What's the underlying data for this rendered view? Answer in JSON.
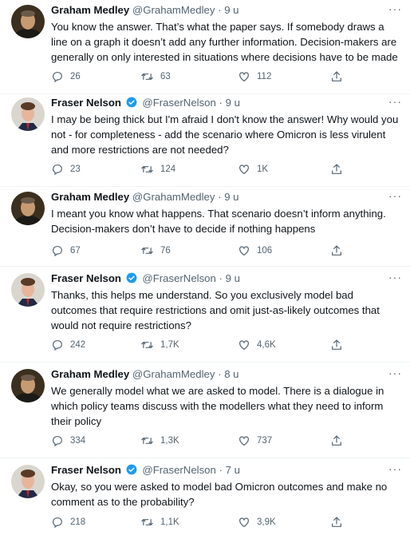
{
  "tweets": [
    {
      "name": "Graham Medley",
      "handle": "@GrahamMedley",
      "time": "9 u",
      "verified": false,
      "text": "You know the answer. That’s what the paper says. If somebody draws a line on a graph it doesn’t add any further information. Decision-makers are generally on only interested in situations where decisions have to be made",
      "replies": "26",
      "retweets": "63",
      "likes": "112"
    },
    {
      "name": "Fraser Nelson",
      "handle": "@FraserNelson",
      "time": "9 u",
      "verified": true,
      "text": "I may be being thick but I'm afraid I don't know the answer! Why would you not - for completeness - add the scenario where Omicron is less virulent and more restrictions are not needed?",
      "replies": "23",
      "retweets": "124",
      "likes": "1K"
    },
    {
      "name": "Graham Medley",
      "handle": "@GrahamMedley",
      "time": "9 u",
      "verified": false,
      "text": "I meant you know what happens. That scenario doesn’t inform anything. Decision-makers don’t have to decide if nothing happens",
      "replies": "67",
      "retweets": "76",
      "likes": "106"
    },
    {
      "name": "Fraser Nelson",
      "handle": "@FraserNelson",
      "time": "9 u",
      "verified": true,
      "text": "Thanks, this helps me understand. So you exclusively model bad outcomes that require restrictions and omit just-as-likely outcomes that would not require restrictions?",
      "replies": "242",
      "retweets": "1,7K",
      "likes": "4,6K"
    },
    {
      "name": "Graham Medley",
      "handle": "@GrahamMedley",
      "time": "8 u",
      "verified": false,
      "text": "We generally model what we are asked to model. There is a dialogue in which policy teams discuss with the modellers what they need to inform their policy",
      "replies": "334",
      "retweets": "1,3K",
      "likes": "737"
    },
    {
      "name": "Fraser Nelson",
      "handle": "@FraserNelson",
      "time": "7 u",
      "verified": true,
      "text": "Okay, so you were asked to model bad Omicron outcomes and make no comment as to the probability?",
      "replies": "218",
      "retweets": "1,1K",
      "likes": "3,9K"
    }
  ],
  "separator": "·",
  "more_glyph": "···",
  "colors": {
    "verified": "#1d9bf0",
    "muted": "#536471",
    "text": "#0f1419"
  },
  "icons": [
    "reply-icon",
    "retweet-icon",
    "like-icon",
    "share-icon",
    "more-icon",
    "verified-badge-icon"
  ]
}
